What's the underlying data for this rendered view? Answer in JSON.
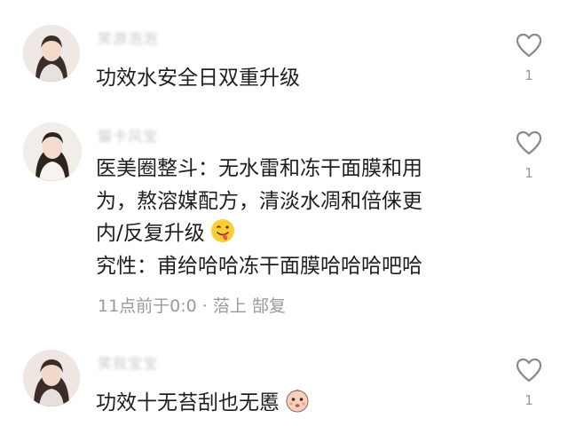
{
  "comments": [
    {
      "username": "笑游泡泡",
      "lines": [
        "功效水安全日双重升级"
      ],
      "like_icon": "heart-outline-icon",
      "like_count": "1"
    },
    {
      "username": "猫卡风宝",
      "lines": [
        "医美圈整斗：无水雷和冻干面膜和用",
        "为，熬溶媒配方，清淡水凋和倍俫更",
        "内/反复升级",
        "究性：甫给哈哈冻干面膜哈哈哈吧哈"
      ],
      "emoji_icon": "tongue-out-face-emoji-icon",
      "meta": "11点前于0:0 · 菭上 郜复",
      "like_icon": "heart-outline-icon",
      "like_count": "1"
    },
    {
      "username": "笑我宝宝",
      "lines": [
        "功效十无苔刮也无慝"
      ],
      "emoji_icon": "baby-face-emoji-icon",
      "like_icon": "heart-outline-icon",
      "like_count": "1"
    }
  ],
  "colors": {
    "text": "#1e1e1e",
    "meta": "#9a9a9a",
    "username": "#c9c9c9",
    "icon": "#8a8a8a"
  }
}
